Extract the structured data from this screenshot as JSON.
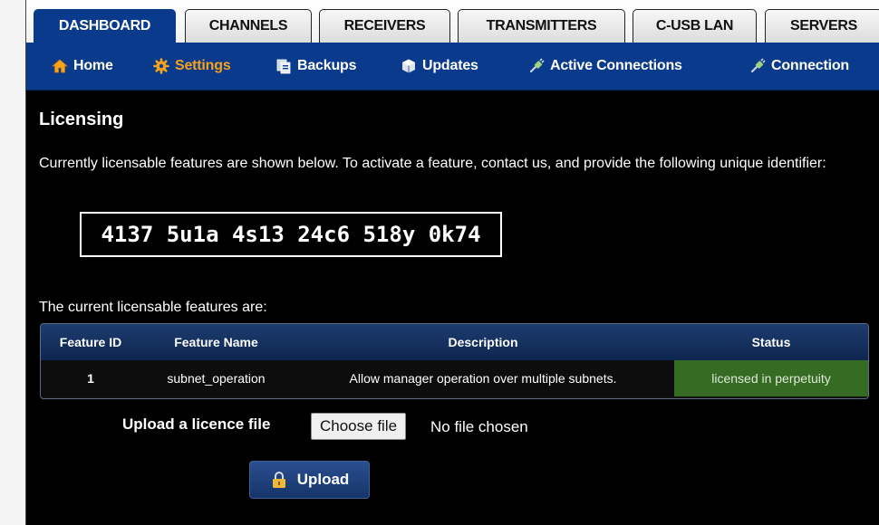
{
  "tabs": [
    {
      "label": "DASHBOARD",
      "active": true
    },
    {
      "label": "CHANNELS"
    },
    {
      "label": "RECEIVERS"
    },
    {
      "label": "TRANSMITTERS"
    },
    {
      "label": "C-USB LAN"
    },
    {
      "label": "SERVERS"
    }
  ],
  "subnav": [
    {
      "label": "Home",
      "icon": "home-icon"
    },
    {
      "label": "Settings",
      "icon": "gear-icon",
      "active": true
    },
    {
      "label": "Backups",
      "icon": "backup-icon"
    },
    {
      "label": "Updates",
      "icon": "cube-icon"
    },
    {
      "label": "Active Connections",
      "icon": "plug-icon"
    },
    {
      "label": "Connection",
      "icon": "plug-icon"
    }
  ],
  "page": {
    "title": "Licensing",
    "description": "Currently licensable features are shown below. To activate a feature, contact us, and provide the following unique identifier:",
    "identifier": "4137 5u1a 4s13 24c6 518y 0k74",
    "features_heading": "The current licensable features are:"
  },
  "table": {
    "headers": [
      "Feature ID",
      "Feature Name",
      "Description",
      "Status"
    ],
    "rows": [
      [
        "1",
        "subnet_operation",
        "Allow manager operation over multiple subnets.",
        "licensed in perpetuity"
      ]
    ]
  },
  "upload": {
    "label": "Upload a licence file",
    "choose_label": "Choose file",
    "file_status": "No file chosen",
    "button_label": "Upload"
  },
  "colors": {
    "nav_blue": "#0a3a8c",
    "active_orange": "#f7a21b",
    "status_green": "#356b22"
  }
}
